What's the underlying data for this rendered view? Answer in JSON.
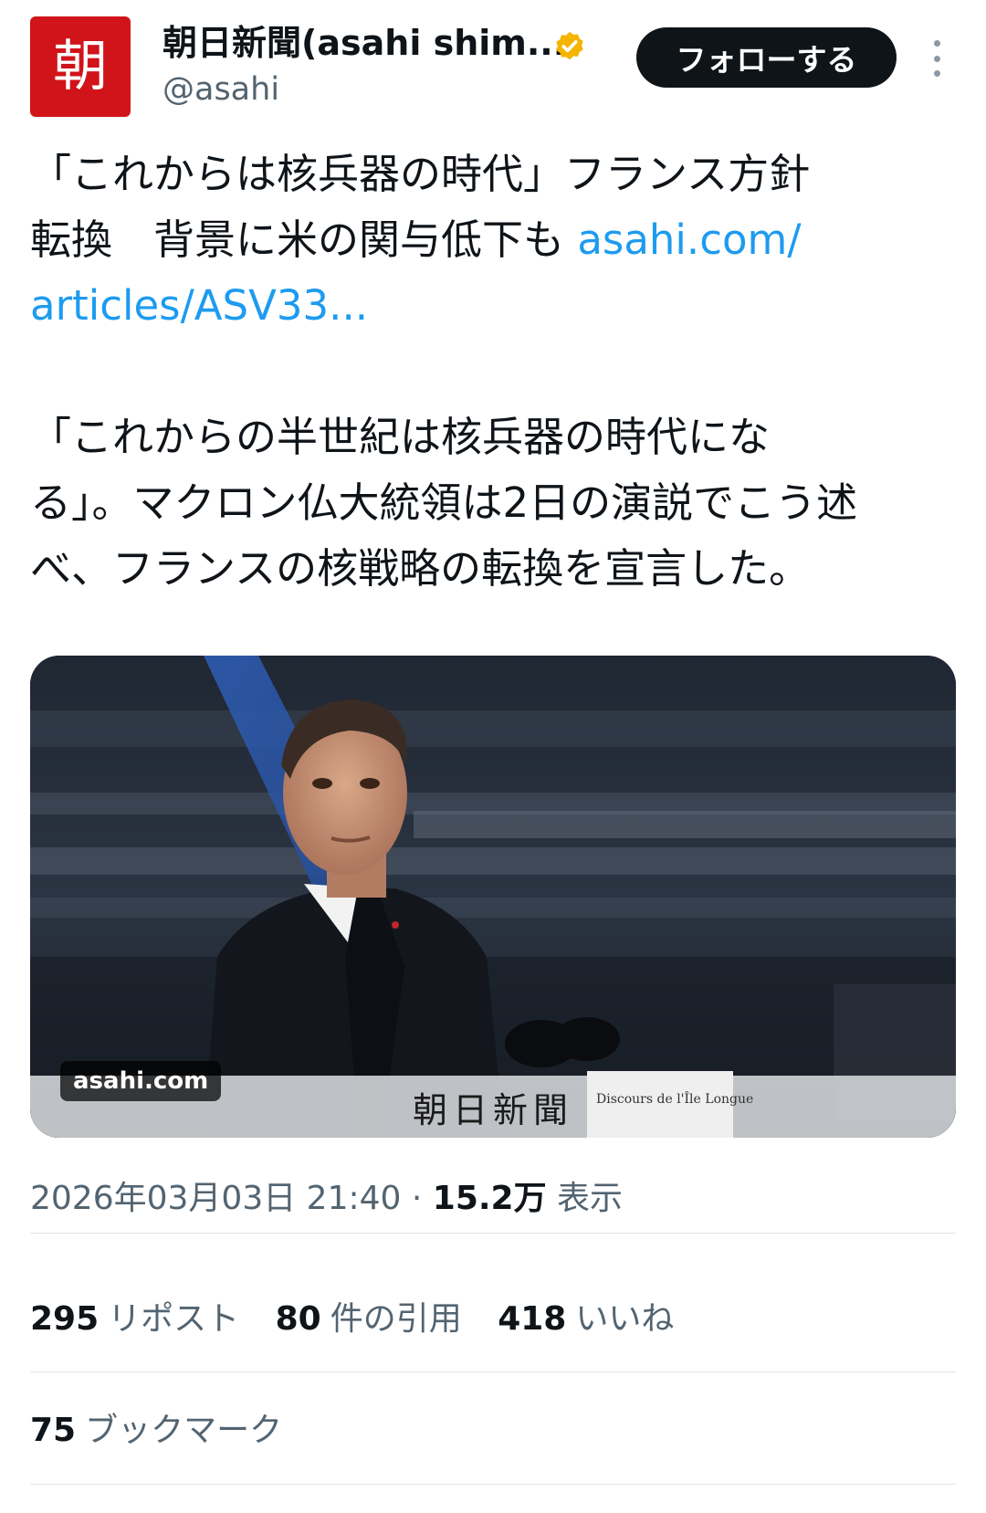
{
  "account": {
    "avatar_text": "朝",
    "display_name": "朝日新聞(asahi shim...",
    "handle": "@asahi",
    "verified_badge_color": "#f4b400",
    "avatar_color": "#d0141a"
  },
  "header": {
    "follow_label": "フォローする",
    "more_icon": "more-vertical-icon"
  },
  "tweet": {
    "line1": "「これからは核兵器の時代」フランス方針",
    "line2_text": "転換　背景に米の関与低下も ",
    "line2_link": "asahi.com/",
    "line3_link": "articles/ASV33...",
    "line4": "「これからの半世紀は核兵器の時代にな",
    "line5": "る」。マクロン仏大統領は2日の演説でこう述",
    "line6": "べ、フランスの核戦略の転換を宣言した。"
  },
  "media": {
    "source_badge": "asahi.com",
    "caption": "朝日新聞",
    "podium_sign": "Discours de l'Île Longue"
  },
  "meta": {
    "timestamp": "2026年03月03日 21:40",
    "separator": " · ",
    "views_count": "15.2万",
    "views_label": " 表示"
  },
  "stats": {
    "reposts_count": "295",
    "reposts_label": "リポスト",
    "quotes_count": "80",
    "quotes_label": "件の引用",
    "likes_count": "418",
    "likes_label": "いいね",
    "bookmarks_count": "75",
    "bookmarks_label": "ブックマーク"
  },
  "colors": {
    "link": "#1d9bf0",
    "text": "#0f1419",
    "muted": "#536471",
    "follow_button": "#0f1419"
  }
}
